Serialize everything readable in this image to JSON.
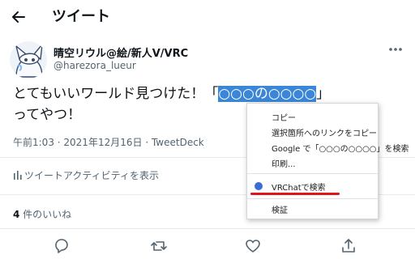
{
  "header": {
    "title": "ツイート"
  },
  "author": {
    "display_name": "晴空リウル@絵/新人V/VRC",
    "handle": "@harezora_lueur"
  },
  "tweet": {
    "text_before": "とてもいいワールド見つけた！「",
    "selected_text": "○○○の○○○○",
    "text_after": "」",
    "text_line2": "ってやつ！"
  },
  "meta": {
    "time": "午前1:03",
    "separator": " · ",
    "date": "2021年12月16日",
    "client": "TweetDeck"
  },
  "activity": {
    "label": "ツイートアクティビティを表示"
  },
  "likes": {
    "count": "4",
    "label": " 件のいいね"
  },
  "actions": [
    "reply",
    "retweet",
    "like",
    "share"
  ],
  "context_menu": {
    "items": [
      "コピー",
      "選択箇所へのリンクをコピー",
      "Google で「○○○の○○○○」を検索",
      "印刷...",
      "VRChatで検索",
      "検証"
    ],
    "highlighted_item": "VRChatで検索",
    "underline_color": "#e1141b"
  },
  "colors": {
    "selection": "#3b86d6",
    "secondary_text": "#536471",
    "icon": "#536471"
  }
}
